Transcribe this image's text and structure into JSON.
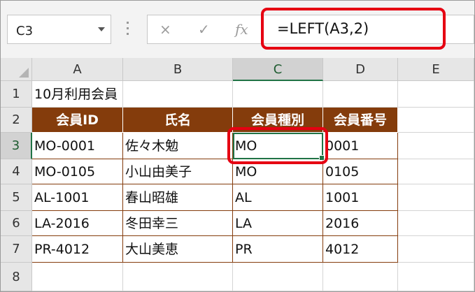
{
  "formula_bar": {
    "name_box": "C3",
    "cancel_icon": "×",
    "enter_icon": "✓",
    "function_icon": "fx",
    "formula": "=LEFT(A3,2)"
  },
  "columns": [
    "A",
    "B",
    "C",
    "D",
    "E"
  ],
  "selected_column": "C",
  "rows": [
    "1",
    "2",
    "3",
    "4",
    "5",
    "6",
    "7",
    "8"
  ],
  "selected_row": "3",
  "sheet": {
    "title": "10月利用会員",
    "headers": [
      "会員ID",
      "氏名",
      "会員種別",
      "会員番号"
    ],
    "records": [
      [
        "MO-0001",
        "佐々木勉",
        "MO",
        "0001"
      ],
      [
        "MO-0105",
        "小山由美子",
        "MO",
        "0105"
      ],
      [
        "AL-1001",
        "春山昭雄",
        "AL",
        "1001"
      ],
      [
        "LA-2016",
        "冬田幸三",
        "LA",
        "2016"
      ],
      [
        "PR-4012",
        "大山美恵",
        "PR",
        "4012"
      ]
    ]
  },
  "colors": {
    "header_fill": "#843c0c",
    "header_text": "#ffffff",
    "selection": "#217346",
    "highlight": "#e60012"
  }
}
